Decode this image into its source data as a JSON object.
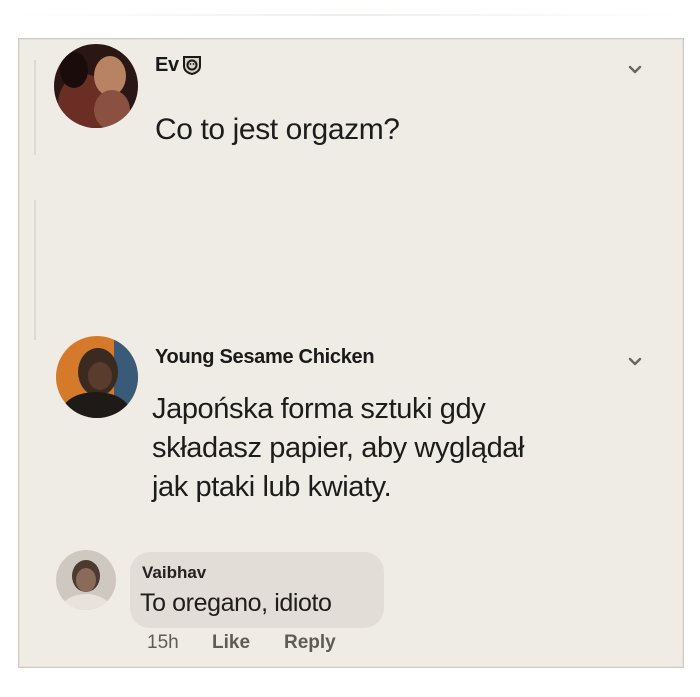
{
  "post": {
    "author": "Ev",
    "badge_icon": "lion-badge-icon",
    "text": "Co to jest orgazm?"
  },
  "comment": {
    "author": "Young Sesame Chicken",
    "text_lines": [
      "Japońska forma sztuki gdy",
      "składasz papier, aby wyglądał",
      "jak ptaki lub kwiaty."
    ]
  },
  "reply": {
    "author": "Vaibhav",
    "text": "To oregano, idioto",
    "time": "15h",
    "like_label": "Like",
    "reply_label": "Reply"
  },
  "colors": {
    "background": "#efebe5",
    "bubble": "#e2ddd6",
    "text": "#1c1c1c",
    "meta": "#5f5b56"
  }
}
